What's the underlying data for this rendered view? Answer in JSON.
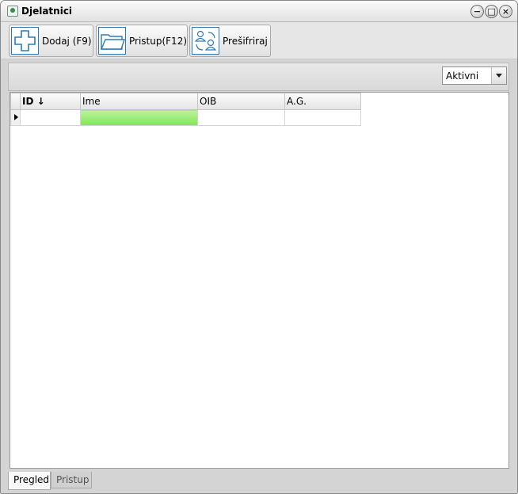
{
  "window": {
    "title": "Djelatnici",
    "icon": "app-tree-icon",
    "controls": {
      "minimize": "−",
      "maximize": "□",
      "close": "×"
    }
  },
  "toolbar": {
    "buttons": [
      {
        "label": "Dodaj (F9)",
        "icon": "plus-icon"
      },
      {
        "label": "Pristup(F12)",
        "icon": "folder-icon"
      },
      {
        "label": "Prešifriraj",
        "icon": "users-sync-icon"
      }
    ]
  },
  "filter": {
    "selected": "Aktivni"
  },
  "grid": {
    "columns": [
      {
        "label": "ID ↓"
      },
      {
        "label": "Ime"
      },
      {
        "label": "OIB"
      },
      {
        "label": "A.G."
      }
    ],
    "rows": [
      {
        "id": "",
        "ime": "",
        "oib": "",
        "ag": ""
      }
    ]
  },
  "tabs": [
    {
      "label": "Pregled",
      "active": true
    },
    {
      "label": "Pristup",
      "active": false
    }
  ],
  "colors": {
    "accent": "#2b7bb9",
    "selection": "#84e45a"
  }
}
